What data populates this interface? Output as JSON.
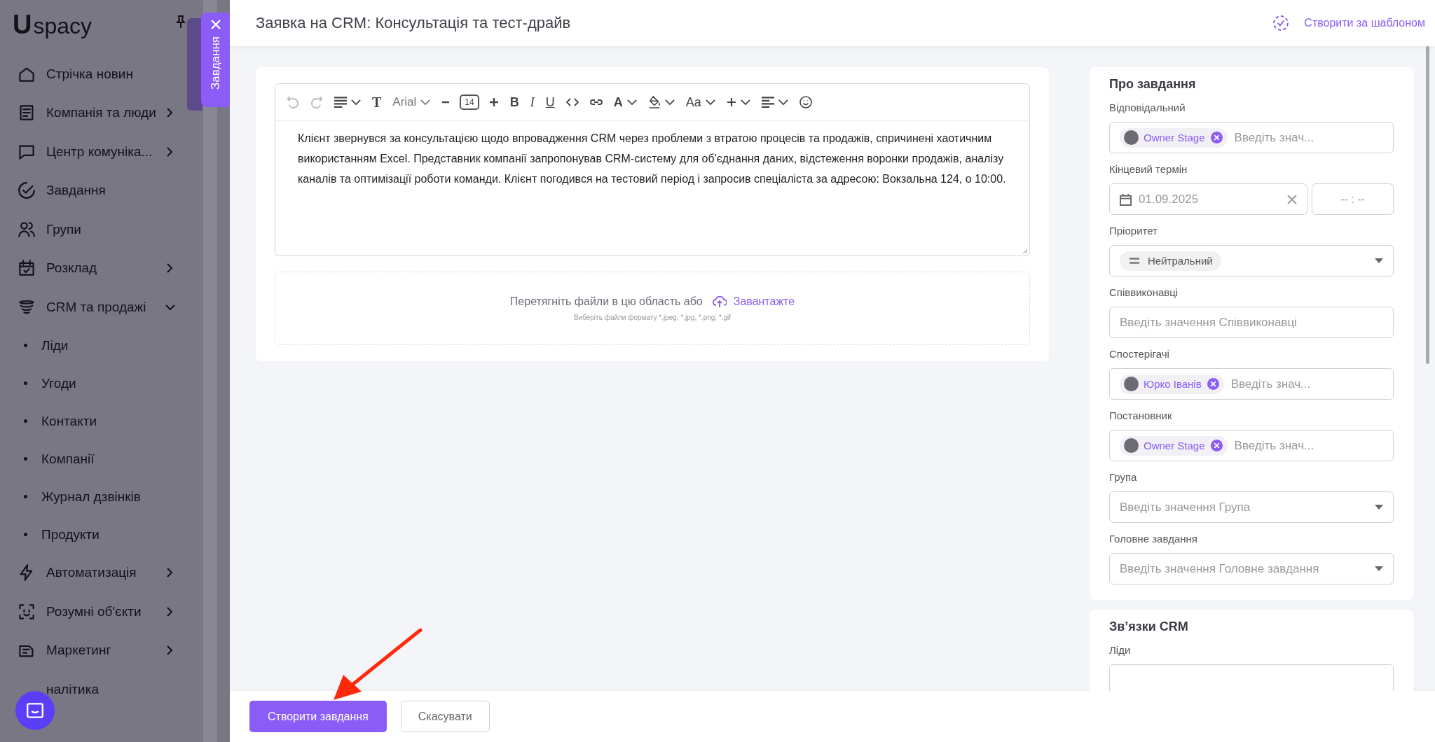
{
  "sidebar": {
    "logo": {
      "mark": "U",
      "text": "spacy"
    },
    "items": [
      {
        "label": "Стрічка новин",
        "submenu": false,
        "expanded": false
      },
      {
        "label": "Компанія та люди",
        "submenu": true,
        "expanded": false
      },
      {
        "label": "Центр комуніка...",
        "submenu": true,
        "expanded": false
      },
      {
        "label": "Завдання",
        "submenu": false,
        "expanded": false
      },
      {
        "label": "Групи",
        "submenu": false,
        "expanded": false
      },
      {
        "label": "Розклад",
        "submenu": true,
        "expanded": false
      },
      {
        "label": "CRM та продажі",
        "submenu": true,
        "expanded": true,
        "children": [
          {
            "label": "Ліди"
          },
          {
            "label": "Угоди"
          },
          {
            "label": "Контакти"
          },
          {
            "label": "Компанії"
          },
          {
            "label": "Журнал дзвінків"
          },
          {
            "label": "Продукти"
          }
        ]
      },
      {
        "label": "Автоматизація",
        "submenu": true,
        "expanded": false
      },
      {
        "label": "Розумні об'єкти",
        "submenu": true,
        "expanded": false
      },
      {
        "label": "Маркетинг",
        "submenu": true,
        "expanded": false
      },
      {
        "label": "налітика",
        "submenu": false,
        "expanded": false
      }
    ]
  },
  "side_tab": {
    "label": "Завдання"
  },
  "header": {
    "title": "Заявка на CRM: Консультація та тест-драйв",
    "template_link": "Створити за шаблоном"
  },
  "editor": {
    "toolbar": {
      "undo_disabled": true,
      "redo_disabled": true,
      "text_style": "T",
      "font": "Arial",
      "font_size": "14",
      "bold": "B",
      "italic": "I",
      "underline": "U",
      "font_color": "A",
      "text_case": "Aa"
    },
    "text": "Клієнт звернувся за консультацією щодо впровадження CRM через проблеми з втратою процесів та продажів, спричинені хаотичним використанням Excel. Представник компанії запропонував CRM-систему для об'єднання даних, відстеження воронки продажів, аналізу каналів та оптимізації роботи команди. Клієнт погодився на тестовий період і запросив спеціаліста за адресою: Вокзальна 124, о 10:00."
  },
  "upload": {
    "prompt": "Перетягніть файли в цю область або",
    "link": "Завантажте",
    "hint": "Виберіть файли формату *.jpeg, *.jpg, *.png, *.gif"
  },
  "about": {
    "title": "Про завдання",
    "fields": [
      {
        "kind": "people",
        "label": "Відповідальний",
        "chips": [
          {
            "name": "Owner Stage"
          }
        ],
        "placeholder": "Введіть знач..."
      },
      {
        "kind": "date",
        "label": "Кінцевий термін",
        "value": "01.09.2025",
        "time_placeholder": "-- : --"
      },
      {
        "kind": "priority",
        "label": "Пріоритет",
        "value": "Нейтральний"
      },
      {
        "kind": "text",
        "label": "Співвиконавці",
        "placeholder": "Введіть значення Співвиконавці"
      },
      {
        "kind": "people",
        "label": "Спостерігачі",
        "chips": [
          {
            "name": "Юрко Іванів"
          }
        ],
        "placeholder": "Введіть знач..."
      },
      {
        "kind": "people",
        "label": "Постановник",
        "chips": [
          {
            "name": "Owner Stage"
          }
        ],
        "placeholder": "Введіть знач..."
      },
      {
        "kind": "select",
        "label": "Група",
        "placeholder": "Введіть значення Група"
      },
      {
        "kind": "select",
        "label": "Головне завдання",
        "placeholder": "Введіть значення Головне завдання"
      }
    ]
  },
  "crm_links": {
    "title": "Зв’язки CRM",
    "fields": [
      {
        "kind": "text",
        "label": "Ліди"
      }
    ]
  },
  "actions": {
    "primary": "Створити завдання",
    "cancel": "Скасувати"
  }
}
